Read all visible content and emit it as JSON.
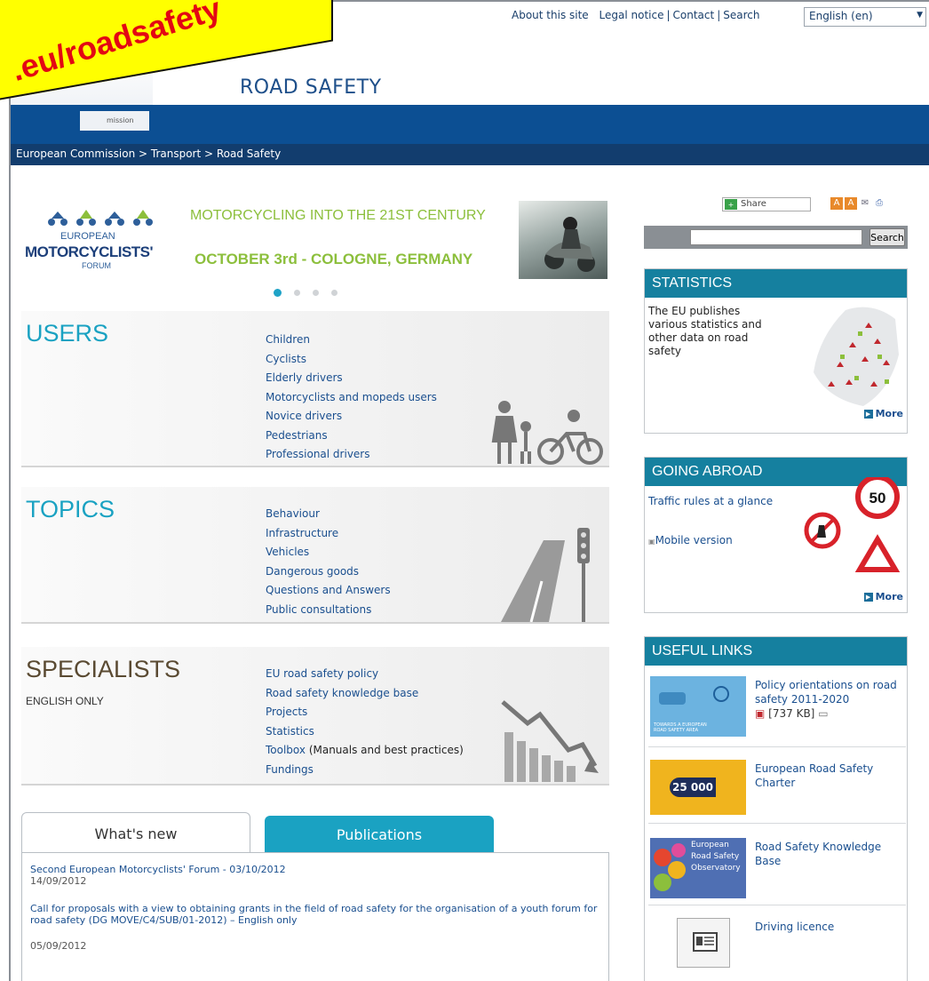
{
  "header": {
    "toplinks": [
      "About this site",
      "Legal notice",
      "Contact",
      "Search"
    ],
    "language": "English (en)",
    "site_title": "ROAD SAFETY",
    "commission_fragment": "mission",
    "breadcrumb": "European Commission > Transport > Road Safety",
    "overlay_stamp": ".eu/roadsafety"
  },
  "banner": {
    "logo_line1": "EUROPEAN",
    "logo_line2": "MOTORCYCLISTS'",
    "logo_line3": "FORUM",
    "headline": "MOTORCYCLING INTO THE 21ST CENTURY",
    "subline": "OCTOBER 3rd - COLOGNE, GERMANY",
    "carousel": {
      "count": 4,
      "active": 1
    }
  },
  "users": {
    "heading": "USERS",
    "links": [
      "Children",
      "Cyclists",
      "Elderly drivers",
      "Motorcyclists and mopeds users",
      "Novice drivers",
      "Pedestrians",
      "Professional drivers"
    ]
  },
  "topics": {
    "heading": "TOPICS",
    "links": [
      "Behaviour",
      "Infrastructure",
      "Vehicles",
      "Dangerous goods",
      "Questions and Answers",
      "Public consultations"
    ]
  },
  "specialists": {
    "heading": "SPECIALISTS",
    "note": "ENGLISH ONLY",
    "links": [
      "EU road safety policy",
      "Road safety knowledge base",
      "Projects",
      "Statistics",
      "Toolbox",
      "Fundings"
    ],
    "toolbox_suffix": " (Manuals and best practices)"
  },
  "tabs": {
    "whats_new": "What's new",
    "publications": "Publications"
  },
  "news": [
    {
      "title": "Second European Motorcyclists' Forum - 03/10/2012",
      "date": "14/09/2012"
    },
    {
      "title": "Call for proposals with a view to obtaining grants in the field of road safety for the organisation of a youth forum for road safety (DG MOVE/C4/SUB/01-2012) – English only",
      "date": "05/09/2012"
    }
  ],
  "sidebar": {
    "share_label": "Share",
    "search_button": "Search",
    "search_value": "",
    "statistics": {
      "heading": "STATISTICS",
      "text": "The EU publishes various statistics and other data on road safety",
      "more": "More"
    },
    "going_abroad": {
      "heading": "GOING ABROAD",
      "link1": "Traffic rules at a glance",
      "link2": "Mobile version",
      "sign_value": "50",
      "more": "More"
    },
    "useful_links": {
      "heading": "USEFUL LINKS",
      "items": [
        {
          "text": "Policy orientations on road safety 2011-2020",
          "extra": "[737 KB]",
          "thumb_text": "TOWARDS A EUROPEAN ROAD SAFETY AREA"
        },
        {
          "text": "European Road Safety Charter",
          "thumb_text": "25 000"
        },
        {
          "text": "Road Safety Knowledge Base",
          "thumb_text": "European Road Safety Observatory"
        },
        {
          "text": "Driving licence"
        }
      ]
    }
  },
  "colors": {
    "brand_blue": "#0c4f93",
    "teal": "#15809f",
    "accent_green": "#8cbf3c",
    "link_blue": "#1a4f8f"
  }
}
